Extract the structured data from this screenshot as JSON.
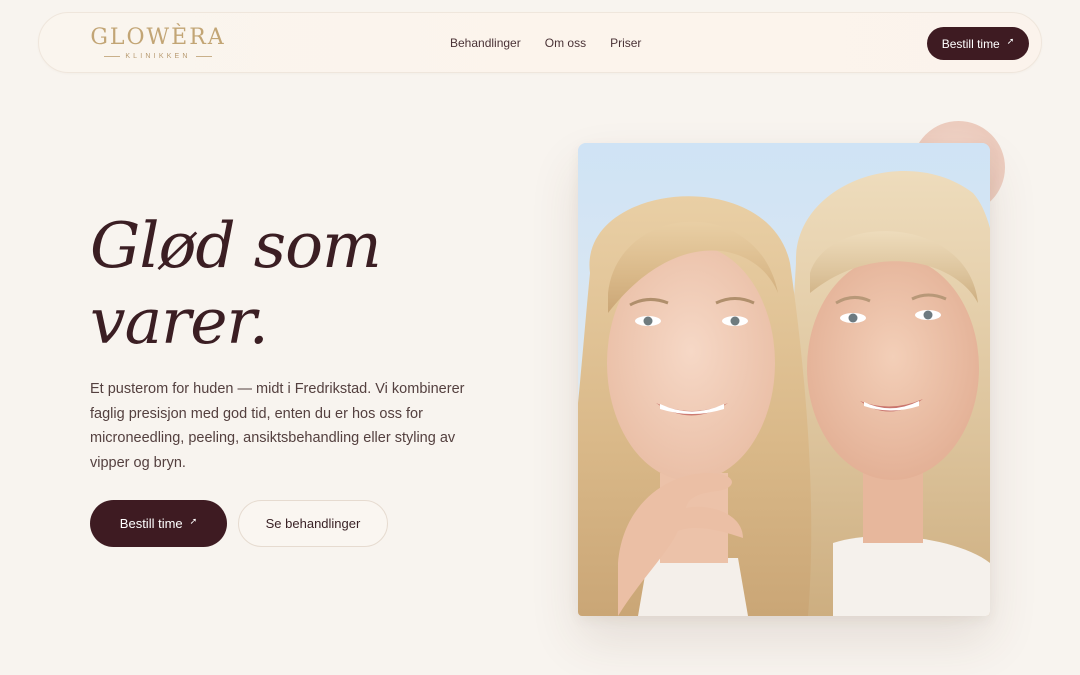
{
  "header": {
    "logo": {
      "name": "GLOWÈRA",
      "subtitle": "KLINIKKEN"
    },
    "nav": [
      {
        "label": "Behandlinger"
      },
      {
        "label": "Om oss"
      },
      {
        "label": "Priser"
      }
    ],
    "cta": {
      "label": "Bestill time",
      "icon": "arrow-up-right-icon"
    }
  },
  "hero": {
    "title_line1": "Glød som",
    "title_line2": "varer.",
    "description": "Et pusterom for huden — midt i Fredrikstad. Vi kombinerer faglig presisjon med god tid, enten du er hos oss for microneedling, peeling, ansiktsbehandling eller styling av vipper og bryn.",
    "primary_button": {
      "label": "Bestill time",
      "icon": "arrow-up-right-icon"
    },
    "secondary_button": {
      "label": "Se behandlinger"
    }
  },
  "colors": {
    "background": "#f8f4ef",
    "brand_dark": "#3e1b22",
    "gold": "#c2a575",
    "accent_blob": "#eccbbd"
  }
}
